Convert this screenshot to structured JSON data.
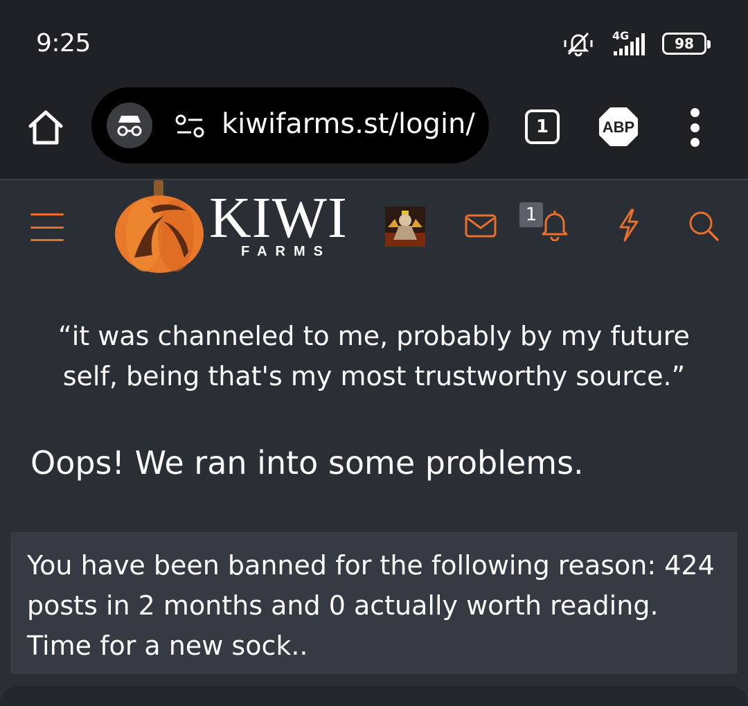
{
  "status_bar": {
    "time": "9:25",
    "network": "4G",
    "battery": "98",
    "icons": [
      "vibrate-off-icon",
      "signal-icon",
      "battery-icon"
    ]
  },
  "browser": {
    "url": "kiwifarms.st/login/",
    "tab_count": "1",
    "extension_label": "ABP",
    "icons": [
      "home-icon",
      "incognito-icon",
      "site-settings-icon",
      "tabs-icon",
      "adblock-icon",
      "more-vert-icon"
    ]
  },
  "site": {
    "logo_text": "KIWI",
    "logo_subtext": "FARMS",
    "notification_count": "1",
    "accent_color": "#e8702a",
    "icons": [
      "menu-icon",
      "pumpkin-logo-icon",
      "avatar",
      "mail-icon",
      "bell-icon",
      "bolt-icon",
      "search-icon"
    ]
  },
  "content": {
    "quote": "“it was channeled to me, probably by my future self, being that's my most trustworthy source.”",
    "error_title": "Oops! We ran into some problems.",
    "ban_message": "You have been banned for the following reason: 424 posts in 2 months and 0 actually worth reading. Time for a new sock.."
  }
}
